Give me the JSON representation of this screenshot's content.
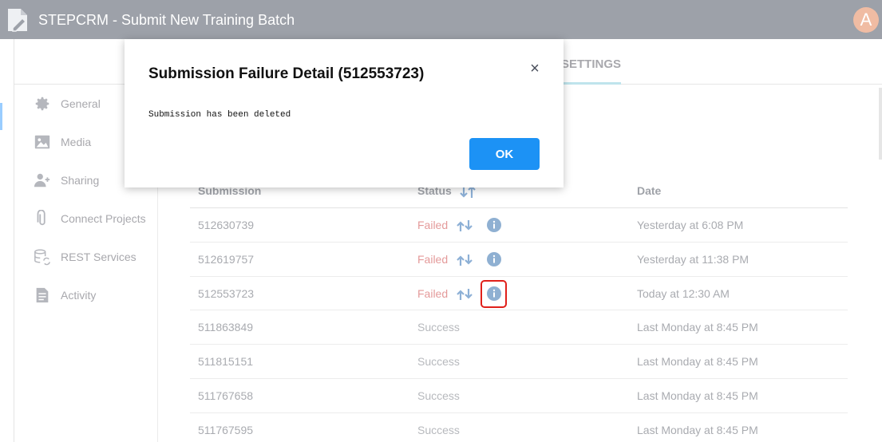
{
  "app": {
    "title": "STEPCRM - Submit New Training Batch",
    "avatar_letter": "A",
    "accent_color": "#1c92f5"
  },
  "tabs": {
    "settings_label": "SETTINGS"
  },
  "sidebar": {
    "items": [
      {
        "label": "General",
        "icon": "gear-icon"
      },
      {
        "label": "Media",
        "icon": "image-icon"
      },
      {
        "label": "Sharing",
        "icon": "add-user-icon"
      },
      {
        "label": "Connect Projects",
        "icon": "paperclip-icon"
      },
      {
        "label": "REST Services",
        "icon": "database-sync-icon"
      },
      {
        "label": "Activity",
        "icon": "document-icon"
      }
    ]
  },
  "table": {
    "headers": {
      "submission": "Submission",
      "status": "Status",
      "date": "Date"
    },
    "rows": [
      {
        "submission": "512630739",
        "status": "Failed",
        "date": "Yesterday at 6:08 PM"
      },
      {
        "submission": "512619757",
        "status": "Failed",
        "date": "Yesterday at 11:38 PM"
      },
      {
        "submission": "512553723",
        "status": "Failed",
        "date": "Today at 12:30 AM"
      },
      {
        "submission": "511863849",
        "status": "Success",
        "date": "Last Monday at 8:45 PM"
      },
      {
        "submission": "511815151",
        "status": "Success",
        "date": "Last Monday at 8:45 PM"
      },
      {
        "submission": "511767658",
        "status": "Success",
        "date": "Last Monday at 8:45 PM"
      },
      {
        "submission": "511767595",
        "status": "Success",
        "date": "Last Monday at 8:45 PM"
      }
    ]
  },
  "modal": {
    "title": "Submission Failure Detail (512553723)",
    "close_symbol": "×",
    "message": "Submission has been deleted",
    "ok_label": "OK"
  }
}
